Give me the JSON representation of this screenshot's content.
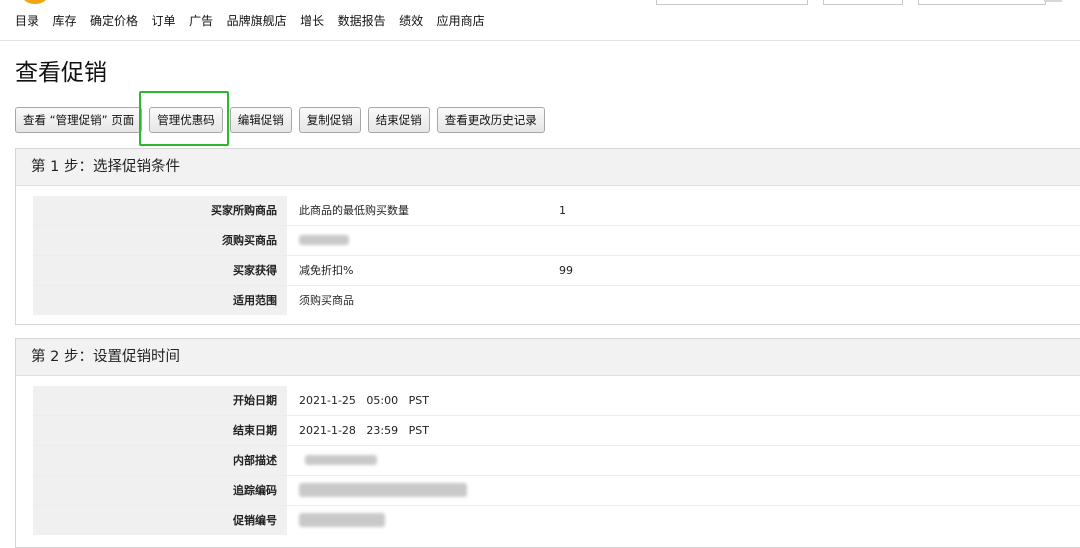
{
  "nav": {
    "items": [
      "目录",
      "库存",
      "确定价格",
      "订单",
      "广告",
      "品牌旗舰店",
      "增长",
      "数据报告",
      "绩效",
      "应用商店"
    ]
  },
  "page_title": "查看促销",
  "toolbar": {
    "view_manage_promotions": "查看 “管理促销” 页面",
    "manage_coupon_codes": "管理优惠码",
    "edit_promotion": "编辑促销",
    "copy_promotion": "复制促销",
    "end_promotion": "结束促销",
    "view_change_history": "查看更改历史记录"
  },
  "step1": {
    "title": "第 1 步：选择促销条件",
    "rows": [
      {
        "label": "买家所购商品",
        "value": "此商品的最低购买数量",
        "value2": "1"
      },
      {
        "label": "须购买商品",
        "value": "",
        "value2": ""
      },
      {
        "label": "买家获得",
        "value": "减免折扣%",
        "value2": "99"
      },
      {
        "label": "适用范围",
        "value": "须购买商品",
        "value2": ""
      }
    ]
  },
  "step2": {
    "title": "第 2 步：设置促销时间",
    "rows": [
      {
        "label": "开始日期",
        "value": "2021-1-25   05:00   PST"
      },
      {
        "label": "结束日期",
        "value": "2021-1-28   23:59   PST"
      },
      {
        "label": "内部描述",
        "value": ""
      },
      {
        "label": "追踪编码",
        "value": ""
      },
      {
        "label": "促销编号",
        "value": ""
      }
    ]
  },
  "colors": {
    "highlight": "#2eb82e",
    "panel_header_bg": "#f2f2f2",
    "label_bg": "#f0f0f0",
    "logo": "#f2a413"
  }
}
